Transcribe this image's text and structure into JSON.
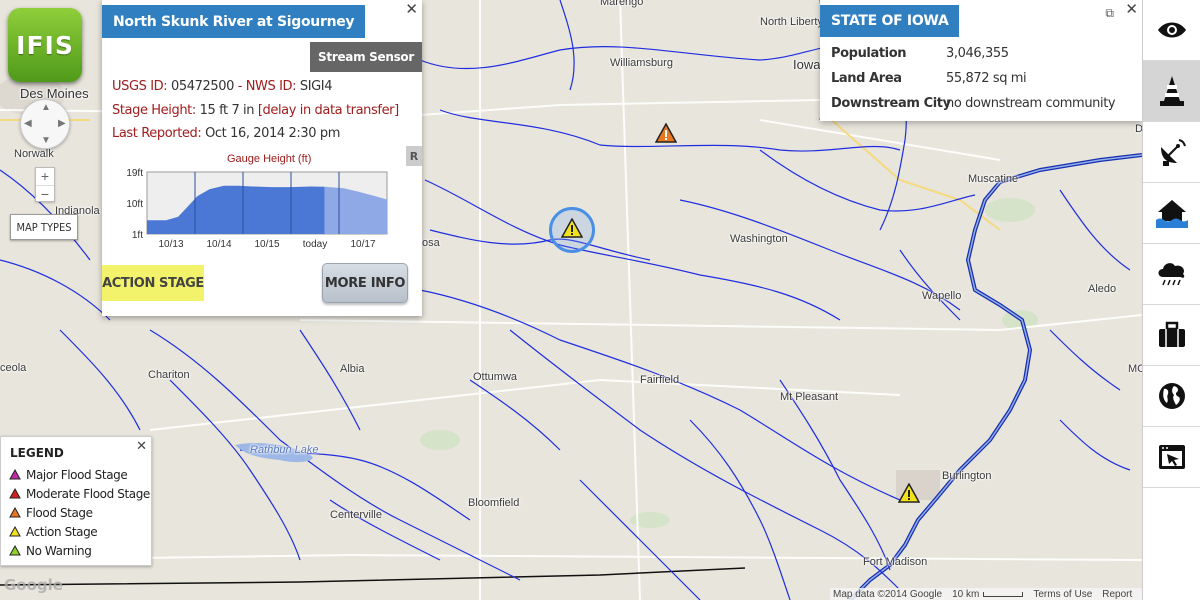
{
  "app": {
    "logo_text": "IFIS"
  },
  "map": {
    "map_types_label": "MAP TYPES",
    "zoom_in": "+",
    "zoom_out": "−",
    "places": [
      {
        "name": "Marengo",
        "cls": ""
      },
      {
        "name": "North Liberty",
        "cls": ""
      },
      {
        "name": "Iowa",
        "cls": "big"
      },
      {
        "name": "Des Moines",
        "cls": "big"
      },
      {
        "name": "Williamsburg",
        "cls": ""
      },
      {
        "name": "Norwalk",
        "cls": ""
      },
      {
        "name": "Indianola",
        "cls": ""
      },
      {
        "name": "Muscatine",
        "cls": ""
      },
      {
        "name": "Washington",
        "cls": ""
      },
      {
        "name": "Wapello",
        "cls": ""
      },
      {
        "name": "Aledo",
        "cls": ""
      },
      {
        "name": "Chariton",
        "cls": ""
      },
      {
        "name": "Albia",
        "cls": ""
      },
      {
        "name": "Ottumwa",
        "cls": ""
      },
      {
        "name": "Fairfield",
        "cls": ""
      },
      {
        "name": "Mt Pleasant",
        "cls": ""
      },
      {
        "name": "Burlington",
        "cls": ""
      },
      {
        "name": "Rathbun Lake",
        "cls": "lake"
      },
      {
        "name": "Centerville",
        "cls": ""
      },
      {
        "name": "Bloomfield",
        "cls": ""
      },
      {
        "name": "Fort Madison",
        "cls": ""
      },
      {
        "name": "osa",
        "cls": ""
      },
      {
        "name": "ceola",
        "cls": ""
      },
      {
        "name": "MC",
        "cls": ""
      },
      {
        "name": "Da",
        "cls": ""
      }
    ],
    "markers": [
      {
        "type": "flood-stage",
        "color": "#e87722"
      },
      {
        "type": "action-stage",
        "color": "#f2e21c",
        "selected": true
      },
      {
        "type": "action-stage",
        "color": "#f2e21c"
      }
    ],
    "google_logo": "Google",
    "attribution": {
      "map_data": "Map data ©2014 Google",
      "scale": "10 km",
      "terms": "Terms of Use",
      "report": "Report"
    }
  },
  "sensor_popup": {
    "title": "North Skunk River at Sigourney",
    "badge": "Stream Sensor",
    "usgs_label": "USGS ID:",
    "usgs_value": "05472500",
    "nws_label": "NWS ID:",
    "nws_value": "SIGI4",
    "stage_label": "Stage Height:",
    "stage_value": "15 ft 7 in",
    "stage_note": "[delay in data transfer]",
    "reported_label": "Last Reported:",
    "reported_value": "Oct 16, 2014 2:30 pm",
    "r_button": "R",
    "stage_status": "ACTION STAGE",
    "stage_status_color": "#f3f36b",
    "more_info": "MORE INFO",
    "close": "✕"
  },
  "chart_data": {
    "type": "area",
    "title": "Gauge Height (ft)",
    "ylabel": "",
    "y_tick_labels": [
      "19ft",
      "10ft",
      "1ft"
    ],
    "y_ticks": [
      19,
      10,
      1
    ],
    "ylim": [
      1,
      19
    ],
    "x_tick_labels": [
      "10/13",
      "10/14",
      "10/15",
      "today",
      "10/17"
    ],
    "x_ticks": [
      0.5,
      1.5,
      2.5,
      3.5,
      4.5
    ],
    "xlim": [
      0,
      5
    ],
    "series": [
      {
        "values": [
          [
            0,
            5
          ],
          [
            0.4,
            5
          ],
          [
            0.65,
            6
          ],
          [
            0.85,
            9
          ],
          [
            1.05,
            12
          ],
          [
            1.3,
            14
          ],
          [
            1.6,
            15
          ],
          [
            1.9,
            15
          ],
          [
            2.2,
            14.8
          ],
          [
            2.6,
            14.6
          ],
          [
            3.0,
            14.6
          ],
          [
            3.4,
            14.8
          ],
          [
            3.7,
            14.7
          ]
        ]
      },
      {
        "values": [
          [
            3.7,
            14.7
          ],
          [
            4.1,
            14.3
          ],
          [
            4.4,
            13.3
          ],
          [
            4.75,
            12
          ],
          [
            5,
            11
          ]
        ]
      }
    ],
    "colors": [
      "#4a78d4",
      "#8fa8e6"
    ]
  },
  "state_popup": {
    "title": "STATE OF IOWA",
    "rows": [
      {
        "label": "Population",
        "value": "3,046,355"
      },
      {
        "label": "Land Area",
        "value": "55,872 sq mi"
      },
      {
        "label": "Downstream City",
        "value": "no downstream community"
      }
    ],
    "close": "✕",
    "external": "⧉"
  },
  "toolbar": {
    "tools": [
      {
        "icon": "eye-icon"
      },
      {
        "icon": "traffic-cone-icon",
        "active": true
      },
      {
        "icon": "satellite-dish-icon"
      },
      {
        "icon": "flooded-house-icon"
      },
      {
        "icon": "rain-cloud-icon"
      },
      {
        "icon": "briefcase-icon"
      },
      {
        "icon": "globe-icon"
      },
      {
        "icon": "cursor-window-icon"
      }
    ]
  },
  "legend": {
    "title": "LEGEND",
    "close": "✕",
    "items": [
      {
        "label": "Major Flood Stage",
        "color": "#c02aa6"
      },
      {
        "label": "Moderate Flood Stage",
        "color": "#d42020"
      },
      {
        "label": "Flood Stage",
        "color": "#e87722"
      },
      {
        "label": "Action Stage",
        "color": "#f2e21c"
      },
      {
        "label": "No Warning",
        "color": "#8fd12a"
      }
    ]
  }
}
